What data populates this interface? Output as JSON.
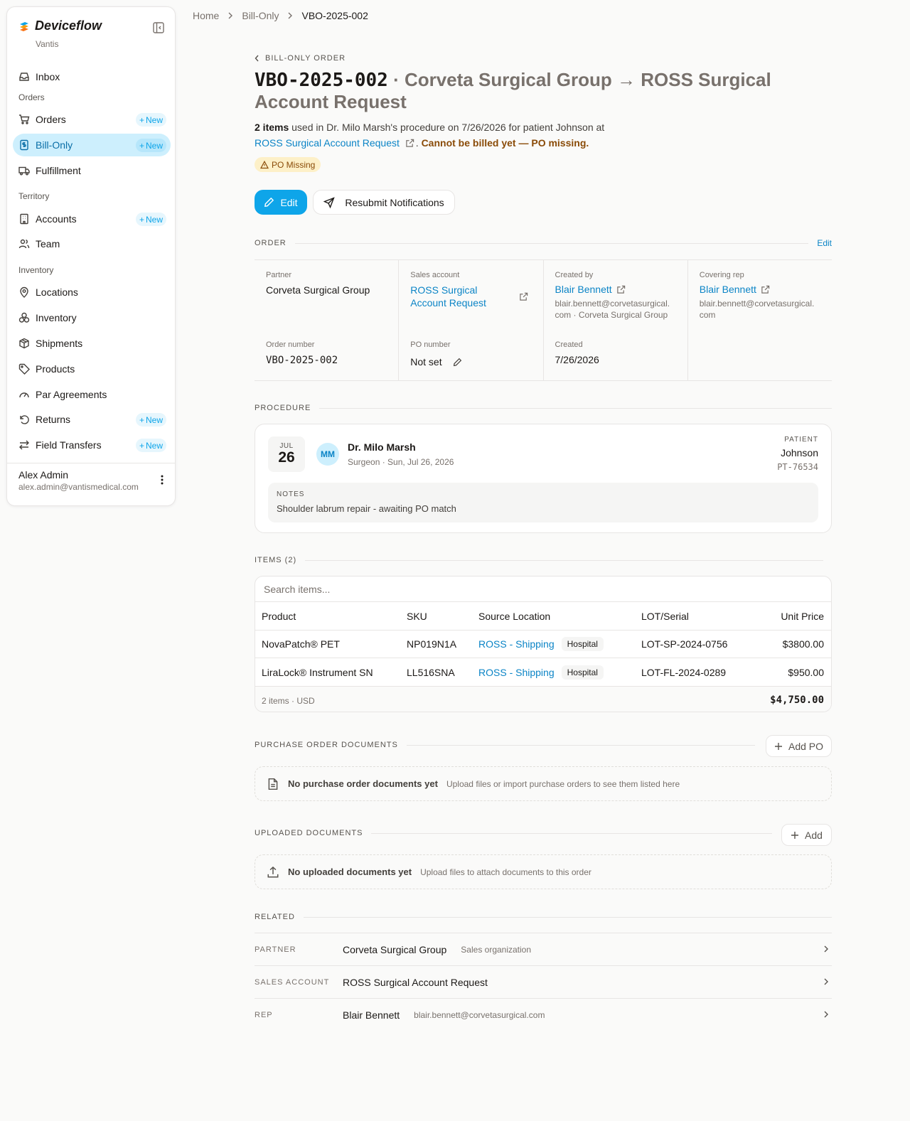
{
  "sidebar": {
    "brand": "Deviceflow",
    "org": "Vantis",
    "inbox": "Inbox",
    "section_orders": "Orders",
    "orders": "Orders",
    "bill_only": "Bill-Only",
    "fulfillment": "Fulfillment",
    "section_territory": "Territory",
    "accounts": "Accounts",
    "team": "Team",
    "section_inventory": "Inventory",
    "locations": "Locations",
    "inventory": "Inventory",
    "shipments": "Shipments",
    "products": "Products",
    "par_agreements": "Par Agreements",
    "returns": "Returns",
    "field_transfers": "Field Transfers",
    "new_label": "New",
    "user_name": "Alex Admin",
    "user_email": "alex.admin@vantismedical.com"
  },
  "breadcrumb": {
    "home": "Home",
    "section": "Bill-Only",
    "current": "VBO-2025-002"
  },
  "header": {
    "eyebrow": "BILL-ONLY ORDER",
    "code": "VBO-2025-002",
    "title_rest": " · Corveta Surgical Group → ROSS Surgical Account Request",
    "items_count": "2 items",
    "summary": " used in Dr. Milo Marsh's procedure on 7/26/2026 for patient Johnson at",
    "account_link": "ROSS Surgical Account Request",
    "sep": ".",
    "warning": "Cannot be billed yet — PO missing.",
    "badge": "PO Missing",
    "edit_label": "Edit",
    "resubmit_label": "Resubmit Notifications"
  },
  "order": {
    "section": "ORDER",
    "edit": "Edit",
    "partner_label": "Partner",
    "partner": "Corveta Surgical Group",
    "sales_account_label": "Sales account",
    "sales_account": "ROSS Surgical Account Request",
    "created_by_label": "Created by",
    "created_by": "Blair Bennett",
    "created_by_email_1": "blair.bennett@corvetasurgical.",
    "created_by_email_2": "com · Corveta Surgical Group",
    "covering_rep_label": "Covering rep",
    "covering_rep": "Blair Bennett",
    "covering_rep_email_1": "blair.bennett@corvetasurgical.",
    "covering_rep_email_2": "com",
    "order_number_label": "Order number",
    "order_number": "VBO-2025-002",
    "po_number_label": "PO number",
    "po_number": "Not set",
    "created_label": "Created",
    "created": "7/26/2026"
  },
  "procedure": {
    "section": "PROCEDURE",
    "month": "JUL",
    "day": "26",
    "initials": "MM",
    "surgeon": "Dr. Milo Marsh",
    "surgeon_sub": "Surgeon · Sun, Jul 26, 2026",
    "patient_label": "PATIENT",
    "patient": "Johnson",
    "patient_id": "PT-76534",
    "notes_label": "NOTES",
    "notes": "Shoulder labrum repair - awaiting PO match"
  },
  "items": {
    "section": "ITEMS (2)",
    "search_placeholder": "Search items...",
    "columns": [
      "Product",
      "SKU",
      "Source Location",
      "LOT/Serial",
      "Unit Price"
    ],
    "rows": [
      {
        "product": "NovaPatch® PET",
        "sku": "NP019N1A",
        "location": "ROSS - Shipping",
        "location_type": "Hospital",
        "lot": "LOT-SP-2024-0756",
        "price": "$3800.00"
      },
      {
        "product": "LiraLock® Instrument SN",
        "sku": "LL516SNA",
        "location": "ROSS - Shipping",
        "location_type": "Hospital",
        "lot": "LOT-FL-2024-0289",
        "price": "$950.00"
      }
    ],
    "footer_count": "2 items · USD",
    "total": "$4,750.00"
  },
  "po_docs": {
    "section": "PURCHASE ORDER DOCUMENTS",
    "add_label": "Add PO",
    "empty_title": "No purchase order documents yet",
    "empty_sub": "Upload files or import purchase orders to see them listed here"
  },
  "uploads": {
    "section": "UPLOADED DOCUMENTS",
    "add_label": "Add",
    "empty_title": "No uploaded documents yet",
    "empty_sub": "Upload files to attach documents to this order"
  },
  "related": {
    "section": "RELATED",
    "rows": [
      {
        "label": "PARTNER",
        "value": "Corveta Surgical Group",
        "sub": "Sales organization"
      },
      {
        "label": "SALES ACCOUNT",
        "value": "ROSS Surgical Account Request",
        "sub": ""
      },
      {
        "label": "REP",
        "value": "Blair Bennett",
        "sub": "blair.bennett@corvetasurgical.com"
      }
    ]
  },
  "colors": {
    "accent": "#0ea5e9",
    "link": "#0b84c6",
    "active_bg": "#cdeffd",
    "warning": "#8a4b08",
    "warning_bg": "#fdf0c8"
  }
}
